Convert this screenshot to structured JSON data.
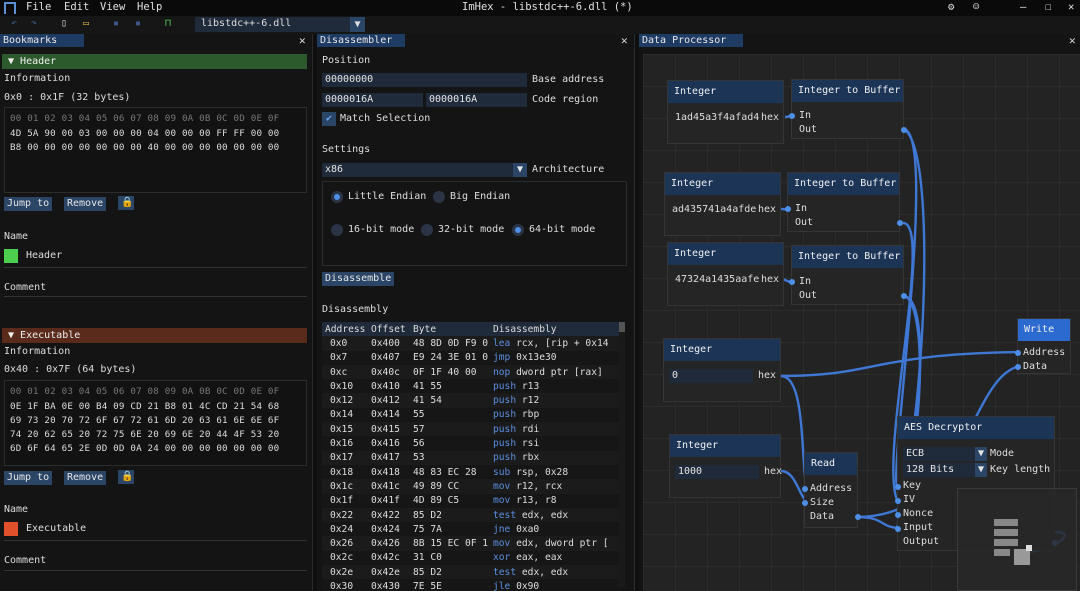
{
  "app": {
    "title": "ImHex - libstdc++-6.dll (*)",
    "menu": [
      "File",
      "Edit",
      "View",
      "Help"
    ],
    "file_selector": "libstdc++-6.dll"
  },
  "bookmarks": {
    "tab": "Bookmarks",
    "items": [
      {
        "name": "Header",
        "info_label": "Information",
        "range": "0x0 : 0x1F (32 bytes)",
        "hex_header": "00 01 02 03 04 05 06 07 08 09 0A 0B 0C 0D 0E 0F",
        "hex_rows": [
          "4D 5A 90 00 03 00 00 00 04 00 00 00 FF FF 00 00",
          "B8 00 00 00 00 00 00 00 40 00 00 00 00 00 00 00"
        ],
        "jump": "Jump to",
        "remove": "Remove",
        "name_label": "Name",
        "name_value": "Header",
        "comment_label": "Comment",
        "color": "#4ccf4c",
        "header_color": "#2d5a2d"
      },
      {
        "name": "Executable",
        "info_label": "Information",
        "range": "0x40 : 0x7F (64 bytes)",
        "hex_header": "00 01 02 03 04 05 06 07 08 09 0A 0B 0C 0D 0E 0F",
        "hex_rows": [
          "0E 1F BA 0E 00 B4 09 CD 21 B8 01 4C CD 21 54 68",
          "69 73 20 70 72 6F 67 72 61 6D 20 63 61 6E 6E 6F",
          "74 20 62 65 20 72 75 6E 20 69 6E 20 44 4F 53 20",
          "6D 6F 64 65 2E 0D 0D 0A 24 00 00 00 00 00 00 00"
        ],
        "jump": "Jump to",
        "remove": "Remove",
        "name_label": "Name",
        "name_value": "Executable",
        "comment_label": "Comment",
        "color": "#e0502a",
        "header_color": "#5a2a1a"
      }
    ]
  },
  "disassembler": {
    "tab": "Disassembler",
    "position_label": "Position",
    "base_address": "00000000",
    "base_address_label": "Base address",
    "region_start": "0000016A",
    "region_end": "0000016A",
    "region_label": "Code region",
    "match_selection": "Match Selection",
    "settings_label": "Settings",
    "architecture": "x86",
    "architecture_label": "Architecture",
    "endian": [
      "Little Endian",
      "Big Endian"
    ],
    "modes": [
      "16-bit mode",
      "32-bit mode",
      "64-bit mode"
    ],
    "disassemble_button": "Disassemble",
    "disassembly_label": "Disassembly",
    "columns": [
      "Address",
      "Offset",
      "Byte",
      "Disassembly"
    ],
    "rows": [
      [
        "0x0",
        "0x400",
        "48 8D 0D F9 0",
        "lea",
        "rcx, [rip + 0x14"
      ],
      [
        "0x7",
        "0x407",
        "E9 24 3E 01 0",
        "jmp",
        "0x13e30"
      ],
      [
        "0xc",
        "0x40c",
        "0F 1F 40 00",
        "nop",
        "dword ptr [rax]"
      ],
      [
        "0x10",
        "0x410",
        "41 55",
        "push",
        "r13"
      ],
      [
        "0x12",
        "0x412",
        "41 54",
        "push",
        "r12"
      ],
      [
        "0x14",
        "0x414",
        "55",
        "push",
        "rbp"
      ],
      [
        "0x15",
        "0x415",
        "57",
        "push",
        "rdi"
      ],
      [
        "0x16",
        "0x416",
        "56",
        "push",
        "rsi"
      ],
      [
        "0x17",
        "0x417",
        "53",
        "push",
        "rbx"
      ],
      [
        "0x18",
        "0x418",
        "48 83 EC 28",
        "sub",
        "rsp, 0x28"
      ],
      [
        "0x1c",
        "0x41c",
        "49 89 CC",
        "mov",
        "r12, rcx"
      ],
      [
        "0x1f",
        "0x41f",
        "4D 89 C5",
        "mov",
        "r13, r8"
      ],
      [
        "0x22",
        "0x422",
        "85 D2",
        "test",
        "edx, edx"
      ],
      [
        "0x24",
        "0x424",
        "75 7A",
        "jne",
        "0xa0"
      ],
      [
        "0x26",
        "0x426",
        "8B 15 EC 0F 1",
        "mov",
        "edx, dword ptr ["
      ],
      [
        "0x2c",
        "0x42c",
        "31 C0",
        "xor",
        "eax, eax"
      ],
      [
        "0x2e",
        "0x42e",
        "85 D2",
        "test",
        "edx, edx"
      ],
      [
        "0x30",
        "0x430",
        "7E 5E",
        "jle",
        "0x90"
      ]
    ]
  },
  "data_processor": {
    "tab": "Data Processor",
    "nodes": {
      "int1": {
        "title": "Integer",
        "value": "1ad45a3f4afad4",
        "unit": "hex"
      },
      "int2": {
        "title": "Integer",
        "value": "ad435741a4afde",
        "unit": "hex"
      },
      "int3": {
        "title": "Integer",
        "value": "47324a1435aafe",
        "unit": "hex"
      },
      "int4": {
        "title": "Integer",
        "value": "0",
        "unit": "hex"
      },
      "int5": {
        "title": "Integer",
        "value": "1000",
        "unit": "hex"
      },
      "buf1": {
        "title": "Integer to Buffer",
        "in": "In",
        "out": "Out"
      },
      "buf2": {
        "title": "Integer to Buffer",
        "in": "In",
        "out": "Out"
      },
      "buf3": {
        "title": "Integer to Buffer",
        "in": "In",
        "out": "Out"
      },
      "write": {
        "title": "Write",
        "address": "Address",
        "data": "Data"
      },
      "read": {
        "title": "Read",
        "address": "Address",
        "size": "Size",
        "data": "Data"
      },
      "aes": {
        "title": "AES Decryptor",
        "mode": "ECB",
        "mode_label": "Mode",
        "bits": "128 Bits",
        "key_length_label": "Key length",
        "key": "Key",
        "iv": "IV",
        "nonce": "Nonce",
        "input": "Input",
        "output": "Output"
      }
    }
  }
}
